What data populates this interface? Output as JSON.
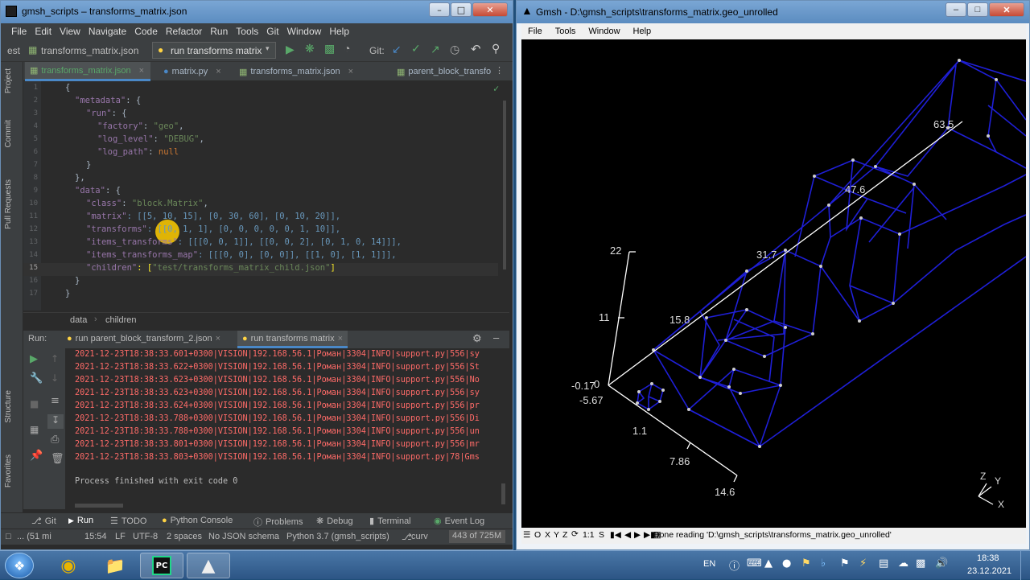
{
  "pycharm": {
    "title": "gmsh_scripts – transforms_matrix.json",
    "menu": [
      "File",
      "Edit",
      "View",
      "Navigate",
      "Code",
      "Refactor",
      "Run",
      "Tools",
      "Git",
      "Window",
      "Help"
    ],
    "toolbar": {
      "project_crumb": "est",
      "file_crumb": "transforms_matrix.json",
      "run_config": "run transforms matrix",
      "git_label": "Git:"
    },
    "tabs": [
      "transforms_matrix.json",
      "matrix.py",
      "transforms_matrix.json",
      "parent_block_transfo"
    ],
    "left_strip": [
      "Project",
      "Commit",
      "Pull Requests"
    ],
    "code": {
      "line_numbers": [
        "1",
        "2",
        "3",
        "4",
        "5",
        "6",
        "7",
        "8",
        "9",
        "10",
        "11",
        "12",
        "13",
        "14",
        "15",
        "16",
        "17"
      ],
      "l1": "{",
      "l2_key": "\"metadata\"",
      "l2_rest": ": {",
      "l3_key": "\"run\"",
      "l3_rest": ": {",
      "l4_key": "\"factory\"",
      "l4_val": "\"geo\"",
      "l4_end": ",",
      "l5_key": "\"log_level\"",
      "l5_val": "\"DEBUG\"",
      "l5_end": ",",
      "l6_key": "\"log_path\"",
      "l6_val": "null",
      "l7": "}",
      "l8": "},",
      "l9_key": "\"data\"",
      "l9_rest": ": {",
      "l10_key": "\"class\"",
      "l10_val": "\"block.Matrix\"",
      "l10_end": ",",
      "l11_key": "\"matrix\"",
      "l11_val": ": [[5, 10, 15], [0, 30, 60], [0, 10, 20]],",
      "l12_key": "\"transforms\"",
      "l12_val": ": [[0, 1, 1], [0, 0, 0, 0, 0, 1, 10]],",
      "l13_key": "\"items_transforms\"",
      "l13_val": ": [[[0, 0, 1]], [[0, 0, 2], [0, 1, 0, 14]]],",
      "l14_key": "\"items_transforms_map\"",
      "l14_val": ": [[[0, 0], [0, 0]], [[1, 0], [1, 1]]],",
      "l15_key": "\"children\"",
      "l15_pre": ": [",
      "l15_val": "\"test/transforms_matrix_child.json\"",
      "l15_post": "]",
      "l16": "}",
      "l17": "}"
    },
    "breadcrumb": [
      "data",
      "children"
    ],
    "run_panel": {
      "label": "Run:",
      "tabs": [
        "run parent_block_transform_2.json",
        "run transforms matrix"
      ],
      "logs": [
        "2021-12-23T18:38:33.601+0300|VISION|192.168.56.1|Роман|3304|INFO|support.py|556|sy",
        "2021-12-23T18:38:33.622+0300|VISION|192.168.56.1|Роман|3304|INFO|support.py|556|St",
        "2021-12-23T18:38:33.623+0300|VISION|192.168.56.1|Роман|3304|INFO|support.py|556|No",
        "2021-12-23T18:38:33.623+0300|VISION|192.168.56.1|Роман|3304|INFO|support.py|556|sy",
        "2021-12-23T18:38:33.624+0300|VISION|192.168.56.1|Роман|3304|INFO|support.py|556|pr",
        "2021-12-23T18:38:33.788+0300|VISION|192.168.56.1|Роман|3304|INFO|support.py|556|Di",
        "2021-12-23T18:38:33.788+0300|VISION|192.168.56.1|Роман|3304|INFO|support.py|556|un",
        "2021-12-23T18:38:33.801+0300|VISION|192.168.56.1|Роман|3304|INFO|support.py|556|mr",
        "2021-12-23T18:38:33.803+0300|VISION|192.168.56.1|Роман|3304|INFO|support.py|78|Gms"
      ],
      "exit_message": "Process finished with exit code 0"
    },
    "left_strip_bottom": [
      "Structure",
      "Favorites"
    ],
    "tool_windows": [
      "Git",
      "Run",
      "TODO",
      "Python Console",
      "Problems",
      "Debug",
      "Terminal",
      "Event Log"
    ],
    "status": {
      "msg": "... (51 mi",
      "pos": "15:54",
      "sep": "LF",
      "enc": "UTF-8",
      "indent": "2 spaces",
      "schema": "No JSON schema",
      "interp": "Python 3.7 (gmsh_scripts)",
      "branch": "curv",
      "memory": "443 of 725M"
    },
    "colors": {
      "accent": "#4a88c7",
      "log_red": "#ff6b68",
      "bg": "#2b2b2b"
    }
  },
  "gmsh": {
    "title": "Gmsh - D:\\gmsh_scripts\\transforms_matrix.geo_unrolled",
    "menu": [
      "File",
      "Tools",
      "Window",
      "Help"
    ],
    "labels": {
      "v635": "63.5",
      "v47": "47.6",
      "v317": "31.7",
      "v22": "22",
      "v158": "15.8",
      "v11": "11",
      "v017": "-0.17",
      "v0": "0",
      "v567": "-5.67",
      "v11b": "1.1",
      "v786": "7.86",
      "v146": "14.6"
    },
    "axes": {
      "z": "Z",
      "y": "Y",
      "x": "X"
    },
    "status_buttons": [
      "O",
      "X",
      "Y",
      "Z",
      "Q",
      "1:1",
      "S"
    ],
    "status_text": "Done reading 'D:\\gmsh_scripts\\transforms_matrix.geo_unrolled'",
    "colors": {
      "mesh": "#1f1fd6",
      "background": "#000000"
    }
  },
  "taskbar": {
    "lang": "EN",
    "time": "18:38",
    "date": "23.12.2021"
  }
}
